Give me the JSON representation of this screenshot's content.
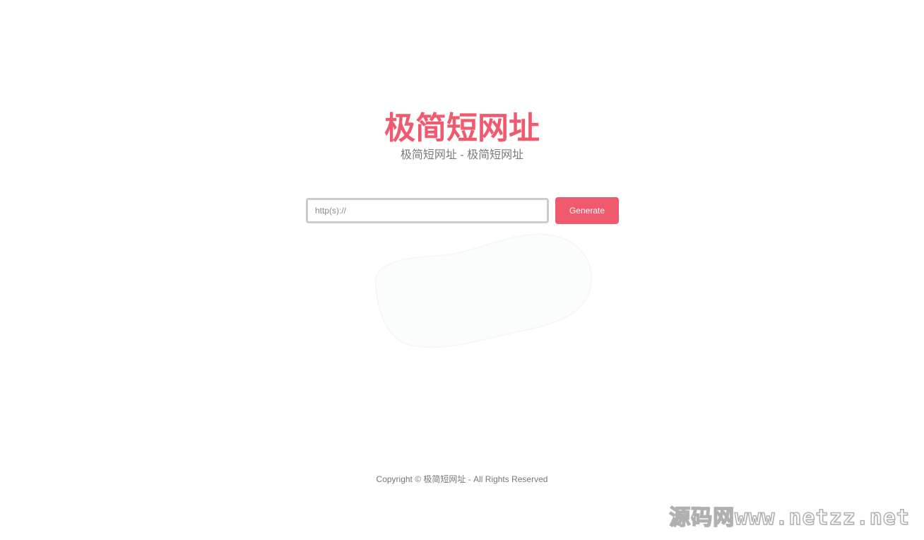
{
  "header": {
    "title": "极简短网址",
    "subtitle": "极简短网址 - 极简短网址"
  },
  "form": {
    "url_placeholder": "http(s)://",
    "url_value": "",
    "generate_label": "Generate"
  },
  "footer": {
    "copyright": "Copyright © 极简短网址 - All Rights Reserved"
  },
  "watermark": {
    "text": "源码网www.netzz.net"
  },
  "colors": {
    "accent": "#ef5a6e",
    "input_border": "#c8cdd1",
    "subtitle_text": "#7a7a7a",
    "footer_text": "#777777"
  }
}
